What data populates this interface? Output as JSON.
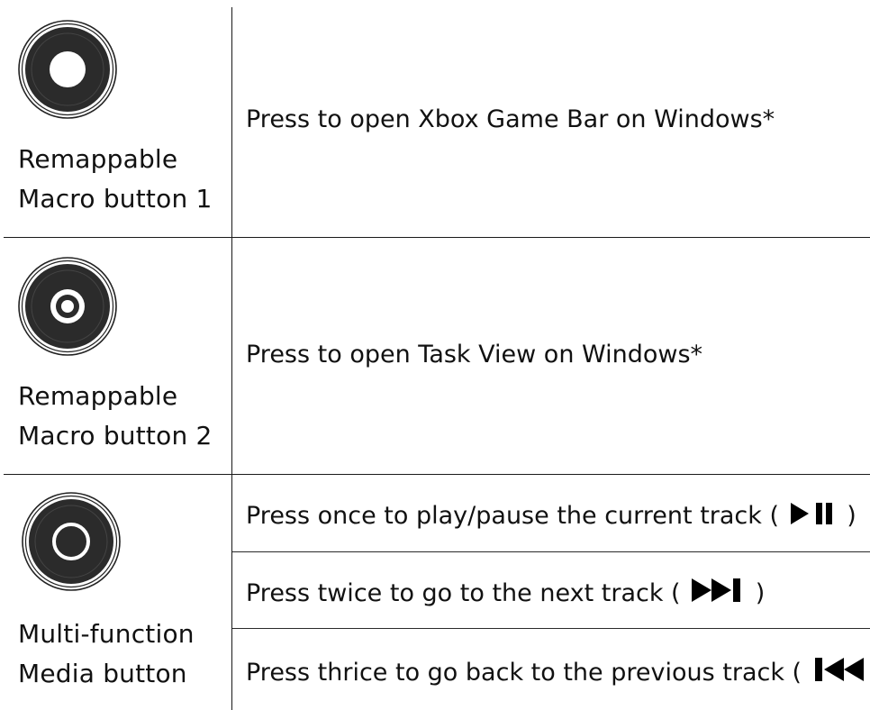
{
  "rows": [
    {
      "button_label_line1": "Remappable",
      "button_label_line2": "Macro button 1",
      "icon": "macro-button-1-icon",
      "descriptions": [
        "Press to open Xbox Game Bar on Windows*"
      ]
    },
    {
      "button_label_line1": "Remappable",
      "button_label_line2": "Macro button 2",
      "icon": "macro-button-2-icon",
      "descriptions": [
        "Press to open Task View on Windows*"
      ]
    },
    {
      "button_label_line1": "Multi-function",
      "button_label_line2": "Media button",
      "icon": "media-button-icon",
      "descriptions": [
        {
          "before": "Press once to play/pause the current track (",
          "after": ")",
          "icon": "play-pause-icon"
        },
        {
          "before": "Press twice to go to the next track (",
          "after": ")",
          "icon": "next-track-icon"
        },
        {
          "before": "Press thrice to go back to the previous track (",
          "after": ")",
          "icon": "previous-track-icon"
        }
      ]
    }
  ]
}
